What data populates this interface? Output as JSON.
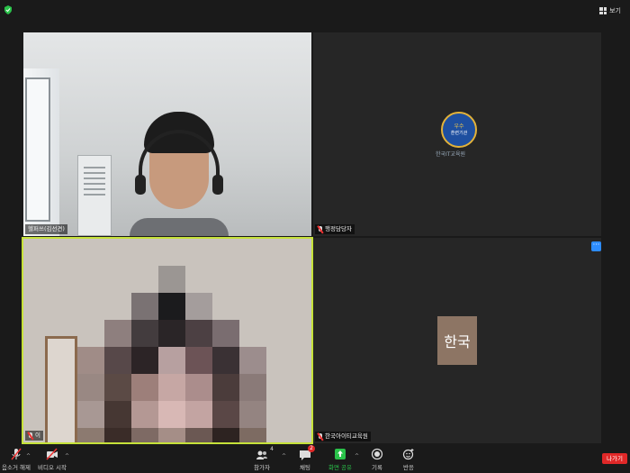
{
  "top_bar": {
    "security_icon": "shield-icon",
    "view_label": "보기"
  },
  "tiles": [
    {
      "name": "헬퍼쓰(김선견)",
      "muted": false
    },
    {
      "name": "행정담당자",
      "muted": true,
      "logo": {
        "line1": "우수",
        "line2": "훈련기관",
        "caption": "한국IT교육원"
      }
    },
    {
      "name": "이",
      "muted": true,
      "active_speaker": true
    },
    {
      "name": "한국아이티교육원",
      "muted": true,
      "avatar_text": "한국",
      "more_label": "···"
    }
  ],
  "toolbar": {
    "unmute_label": "음소거 해제",
    "video_label": "비디오 시작",
    "participants_label": "참가자",
    "participants_count": "4",
    "chat_label": "채팅",
    "chat_badge": "2",
    "share_label": "화면 공유",
    "record_label": "기록",
    "reactions_label": "반응",
    "leave_label": "나가기"
  },
  "colors": {
    "background": "#1a1a1a",
    "active_speaker_border": "#c6e23a",
    "share_green": "#2ac24a",
    "leave_red": "#e02828",
    "accent_blue": "#2d8cff"
  }
}
